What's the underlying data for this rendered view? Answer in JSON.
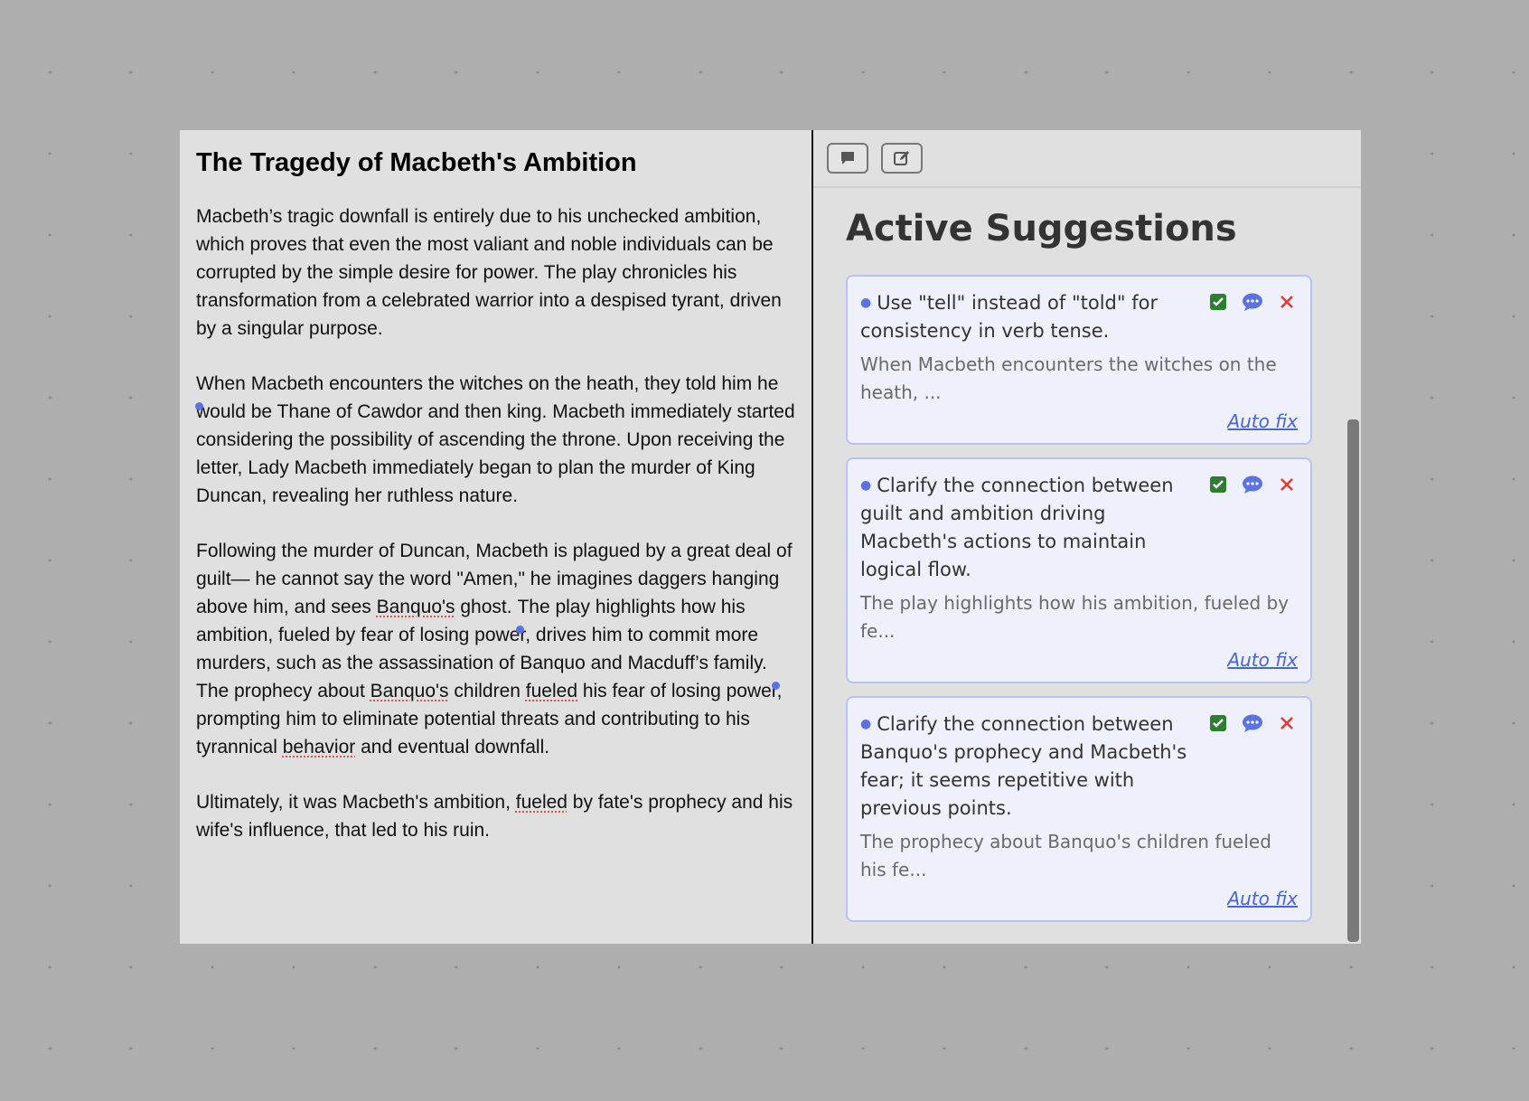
{
  "document": {
    "title": "The Tragedy of Macbeth's Ambition",
    "paragraphs": {
      "p1": "Macbeth’s tragic downfall is entirely due to his unchecked ambition, which proves that even the most valiant and noble individuals can be corrupted by the simple desire for power. The play chronicles his transformation from a celebrated warrior into a despised tyrant, driven by a singular purpose.",
      "p2": "When Macbeth encounters the witches on the heath, they told him he would be Thane of Cawdor and then king. Macbeth immediately started considering the possibility of ascending the throne. Upon receiving the letter, Lady Macbeth immediately began to plan the murder of King Duncan, revealing her ruthless nature.",
      "p3": {
        "a": "Following the murder of Duncan, Macbeth is plagued by a great deal of guilt— he cannot say the word \"Amen,\" he imagines daggers hanging above him, and sees ",
        "b": "Banquo's",
        "c": " ghost. ",
        "d": "The play highlights how his ambition, fueled by fear of losing power, drives him to commit more murders, such as the assassination of Banquo and Macduff’s family. ",
        "e": "The prophecy about ",
        "f": "Banquo's",
        "g": " children ",
        "h": "fueled",
        "i": " his fear of losing power, prompting him to eliminate potential threats and contributing to his tyrannical ",
        "j": "behavior",
        "k": " and eventual downfall."
      },
      "p4": {
        "a": "Ultimately, it was Macbeth's ambition, ",
        "b": "fueled",
        "c": " by fate's prophecy and his wife's influence, that led to his ruin."
      }
    }
  },
  "panel": {
    "title": "Active Suggestions",
    "toolbar": {
      "comment_icon": "comment-icon",
      "edit_icon": "edit-icon"
    },
    "suggestions": [
      {
        "text": "Use \"tell\" instead of \"told\" for consistency in verb tense.",
        "quote": "When Macbeth encounters the witches on the heath, ...",
        "autofix": "Auto fix"
      },
      {
        "text": "Clarify the connection between guilt and ambition driving Macbeth's actions to maintain logical flow.",
        "quote": "The play highlights how his ambition, fueled by fe...",
        "autofix": "Auto fix"
      },
      {
        "text": "Clarify the connection between Banquo's prophecy and Macbeth's fear; it seems repetitive with previous points.",
        "quote": "The prophecy about Banquo's children fueled his fe...",
        "autofix": "Auto fix"
      }
    ]
  },
  "colors": {
    "accent": "#5b73e0",
    "accept": "#2f7d32",
    "reject": "#e53935",
    "card_bg": "#eef0fb",
    "card_border": "#b9c3f1"
  }
}
